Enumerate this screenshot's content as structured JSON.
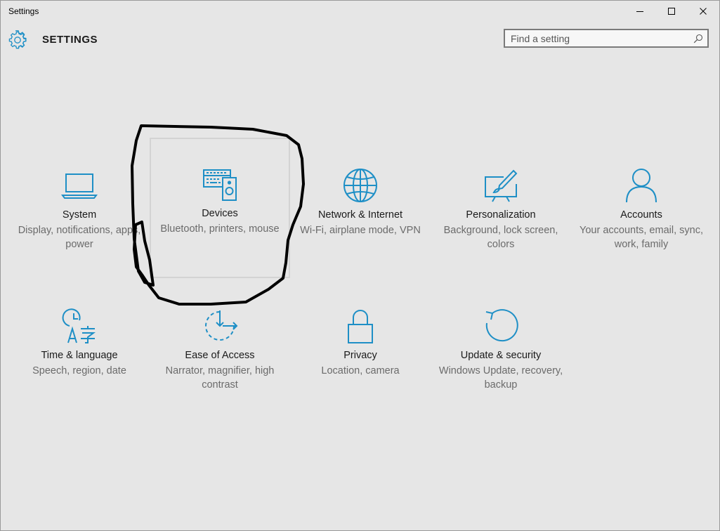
{
  "window": {
    "title": "Settings",
    "controls": [
      "minimize",
      "maximize",
      "close"
    ]
  },
  "header": {
    "title": "SETTINGS",
    "icon": "gear-icon",
    "search_placeholder": "Find a setting"
  },
  "accent_color": "#1e8fc6",
  "categories": [
    {
      "name": "System",
      "description": "Display, notifications, apps, power",
      "icon": "laptop-icon",
      "selected": false
    },
    {
      "name": "Devices",
      "description": "Bluetooth, printers, mouse",
      "icon": "devices-icon",
      "selected": true
    },
    {
      "name": "Network & Internet",
      "description": "Wi-Fi, airplane mode, VPN",
      "icon": "globe-icon",
      "selected": false
    },
    {
      "name": "Personalization",
      "description": "Background, lock screen, colors",
      "icon": "personalization-icon",
      "selected": false
    },
    {
      "name": "Accounts",
      "description": "Your accounts, email, sync, work, family",
      "icon": "person-icon",
      "selected": false
    },
    {
      "name": "Time & language",
      "description": "Speech, region, date",
      "icon": "time-language-icon",
      "selected": false
    },
    {
      "name": "Ease of Access",
      "description": "Narrator, magnifier, high contrast",
      "icon": "ease-of-access-icon",
      "selected": false
    },
    {
      "name": "Privacy",
      "description": "Location, camera",
      "icon": "lock-icon",
      "selected": false
    },
    {
      "name": "Update & security",
      "description": "Windows Update, recovery, backup",
      "icon": "update-icon",
      "selected": false
    }
  ]
}
